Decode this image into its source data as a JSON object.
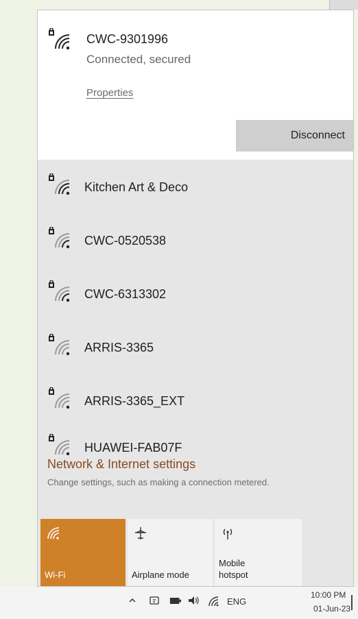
{
  "connected_network": {
    "name": "CWC-9301996",
    "status": "Connected, secured",
    "properties_label": "Properties",
    "disconnect_label": "Disconnect"
  },
  "networks": [
    {
      "name": "Kitchen Art & Deco",
      "signal": 3
    },
    {
      "name": "CWC-0520538",
      "signal": 2
    },
    {
      "name": "CWC-6313302",
      "signal": 2
    },
    {
      "name": "ARRIS-3365",
      "signal": 1
    },
    {
      "name": "ARRIS-3365_EXT",
      "signal": 1
    },
    {
      "name": "HUAWEI-FAB07F",
      "signal": 1
    }
  ],
  "settings": {
    "title": "Network & Internet settings",
    "subtitle": "Change settings, such as making a connection metered."
  },
  "quick_actions": {
    "wifi_label": "Wi-Fi",
    "airplane_label": "Airplane mode",
    "hotspot_label_line1": "Mobile",
    "hotspot_label_line2": "hotspot"
  },
  "taskbar": {
    "language": "ENG",
    "time": "10:00 PM",
    "date": "01-Jun-23"
  },
  "colors": {
    "accent": "#cf8129",
    "settings_link": "#8a4a1f"
  }
}
